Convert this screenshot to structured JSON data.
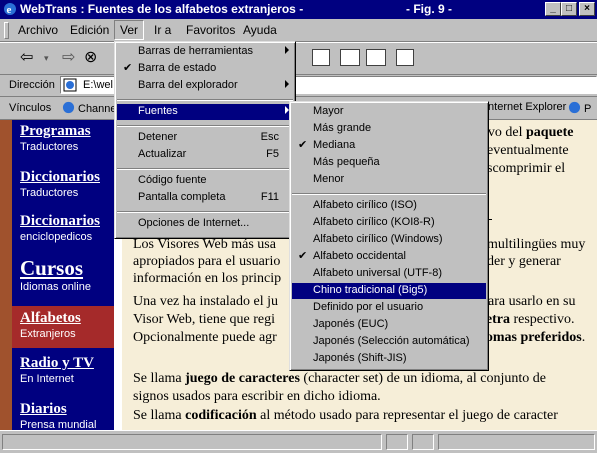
{
  "window": {
    "title": "WebTrans : Fuentes de los alfabetos extranjeros -",
    "figure": "- Fig. 9 -"
  },
  "menubar": {
    "items": [
      {
        "label": "Archivo"
      },
      {
        "label": "Edición"
      },
      {
        "label": "Ver"
      },
      {
        "label": "Ir a"
      },
      {
        "label": "Favoritos"
      },
      {
        "label": "Ayuda"
      }
    ]
  },
  "address": {
    "label": "Dirección",
    "value": "E:\\wel"
  },
  "links": {
    "label": "Vínculos",
    "items": [
      {
        "label": "Channe"
      },
      {
        "label": "Internet Explorer"
      }
    ]
  },
  "ver_menu": {
    "items": [
      {
        "label": "Barras de herramientas",
        "submenu": true,
        "checked": false
      },
      {
        "label": "Barra de estado",
        "submenu": false,
        "checked": true
      },
      {
        "label": "Barra del explorador",
        "submenu": true,
        "checked": false
      },
      {
        "label": "Fuentes",
        "submenu": true,
        "checked": false,
        "highlighted": true
      },
      {
        "label": "Detener",
        "shortcut": "Esc"
      },
      {
        "label": "Actualizar",
        "shortcut": "F5"
      },
      {
        "label": "Código fuente"
      },
      {
        "label": "Pantalla completa",
        "shortcut": "F11"
      },
      {
        "label": "Opciones de Internet..."
      }
    ]
  },
  "fuentes_menu": {
    "sizes": [
      {
        "label": "Mayor",
        "checked": false
      },
      {
        "label": "Más grande",
        "checked": false
      },
      {
        "label": "Mediana",
        "checked": true
      },
      {
        "label": "Más pequeña",
        "checked": false
      },
      {
        "label": "Menor",
        "checked": false
      }
    ],
    "encodings": [
      {
        "label": "Alfabeto cirílico (ISO)",
        "checked": false
      },
      {
        "label": "Alfabeto cirílico (KOI8-R)",
        "checked": false
      },
      {
        "label": "Alfabeto cirílico (Windows)",
        "checked": false
      },
      {
        "label": "Alfabeto occidental",
        "checked": true
      },
      {
        "label": "Alfabeto universal (UTF-8)",
        "checked": false
      },
      {
        "label": "Chino tradicional (Big5)",
        "checked": false,
        "highlighted": true
      },
      {
        "label": "Definido por el usuario",
        "checked": false
      },
      {
        "label": "Japonés (EUC)",
        "checked": false
      },
      {
        "label": "Japonés (Selección automática)",
        "checked": false
      },
      {
        "label": "Japonés (Shift-JIS)",
        "checked": false
      }
    ]
  },
  "sidebar": {
    "items": [
      {
        "title": "Programas",
        "subtitle": "Traductores"
      },
      {
        "title": "Diccionarios",
        "subtitle": "Traductores"
      },
      {
        "title": "Diccionarios",
        "subtitle": "enciclopedicos"
      },
      {
        "title": "Cursos",
        "subtitle": "Idiomas online"
      },
      {
        "title": "Alfabetos",
        "subtitle": "Extranjeros",
        "selected": true
      },
      {
        "title": "Radio y TV",
        "subtitle": "En Internet"
      },
      {
        "title": "Diarios",
        "subtitle": "Prensa mundial"
      }
    ]
  },
  "main": {
    "line1_pre": "ivo del ",
    "line1_bold": "paquete",
    "line2": "eventualmente",
    "line3": "scomprimir el",
    "line5": "Los Visores Web más usa",
    "line5_right": "multilingües muy",
    "line6": "apropiados para el usuario",
    "line6_right": "der y generar",
    "line7": "información en los princip",
    "line8": "Una vez ha instalado el ju",
    "line8_right": "para usarlo en su",
    "line9": "Visor Web, tiene que regi",
    "line9_right_bold": "letra",
    "line9_right": " respectivo.",
    "line10": "Opcionalmente puede agr",
    "line10_right_bold": "iomas preferidos",
    "line10_right": ".",
    "p2_a": "Se llama ",
    "p2_b": "juego de caracteres",
    "p2_c": " (character set) de un idioma, al conjunto de",
    "p2_line2": "signos usados para escribir en dicho idioma.",
    "p3_a": "Se llama ",
    "p3_b": "codificación",
    "p3_c": " al método usado para representar el juego de caracter"
  },
  "colors": {
    "titlebar": "#000080",
    "sidebar": "#000080",
    "sidebar_selected": "#a52a2a",
    "content_bg": "#f6eed8",
    "menu_bg": "#c0c0c0",
    "highlight": "#000080"
  }
}
